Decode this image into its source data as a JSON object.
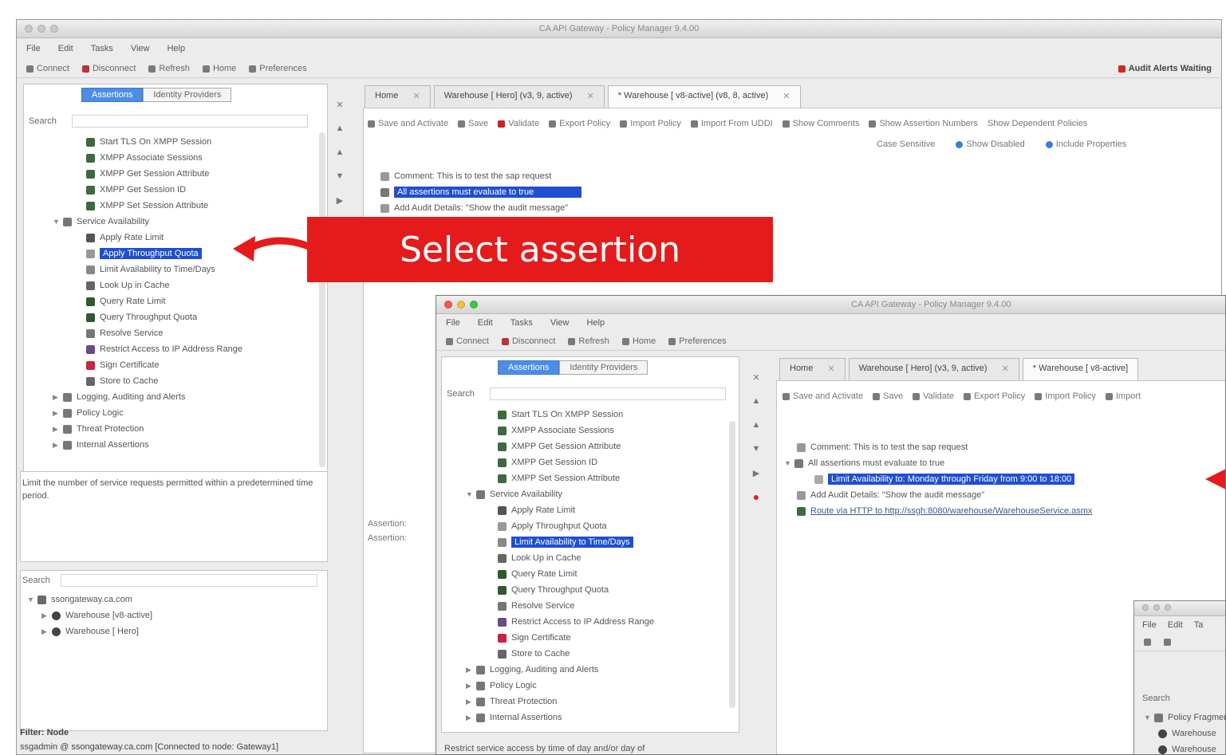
{
  "main_window": {
    "title": "CA API Gateway - Policy Manager 9.4.00",
    "menu": [
      "File",
      "Edit",
      "Tasks",
      "View",
      "Help"
    ],
    "toolbar": [
      "Connect",
      "Disconnect",
      "Refresh",
      "Home",
      "Preferences"
    ],
    "alert": "Audit Alerts Waiting",
    "left_tabs": [
      "Assertions",
      "Identity Providers"
    ],
    "search_label": "Search",
    "assertion_tree": [
      "Start TLS On XMPP Session",
      "XMPP Associate Sessions",
      "XMPP Get Session Attribute",
      "XMPP Get Session ID",
      "XMPP Set Session Attribute",
      "Service Availability",
      "Apply Rate Limit",
      "Apply Throughput Quota",
      "Limit Availability to Time/Days",
      "Look Up in Cache",
      "Query Rate Limit",
      "Query Throughput Quota",
      "Resolve Service",
      "Restrict Access to IP Address Range",
      "Sign Certificate",
      "Store to Cache",
      "Logging, Auditing and Alerts",
      "Policy Logic",
      "Threat Protection",
      "Internal Assertions"
    ],
    "description": "Limit the number of service requests permitted within a predetermined time period.",
    "bottom_search_label": "Search",
    "service_tree": [
      "ssongateway.ca.com",
      "Warehouse [v8-active]",
      "Warehouse [ Hero]"
    ],
    "filter_label": "Filter: Node",
    "status": "ssgadmin @ ssongateway.ca.com [Connected to node: Gateway1]",
    "tabs": [
      "Home",
      "Warehouse [ Hero] (v3, 9, active)",
      "* Warehouse [ v8-active] (v8, 8, active)"
    ],
    "policy_toolbar": [
      "Save and Activate",
      "Save",
      "Validate",
      "Export Policy",
      "Import Policy",
      "Import From UDDI",
      "Show Comments",
      "Show Assertion Numbers",
      "Show Dependent Policies"
    ],
    "search_bar": {
      "case": "Case Sensitive",
      "disabled": "Show Disabled",
      "props": "Include Properties"
    },
    "policy_lines": [
      "Comment: This is to test the sap request",
      "All assertions must evaluate to true",
      "Add Audit Details: \"Show the audit message\""
    ],
    "assertion_labels": [
      "Assertion:",
      "Assertion:"
    ]
  },
  "callout": {
    "text": "Select assertion"
  },
  "second_window": {
    "title": "CA API Gateway - Policy Manager 9.4.00",
    "menu": [
      "File",
      "Edit",
      "Tasks",
      "View",
      "Help"
    ],
    "toolbar": [
      "Connect",
      "Disconnect",
      "Refresh",
      "Home",
      "Preferences"
    ],
    "left_tabs": [
      "Assertions",
      "Identity Providers"
    ],
    "search_label": "Search",
    "tabs": [
      "Home",
      "Warehouse [ Hero] (v3, 9, active)",
      "* Warehouse [ v8-active]"
    ],
    "policy_toolbar": [
      "Save and Activate",
      "Save",
      "Validate",
      "Export Policy",
      "Import Policy",
      "Import"
    ],
    "policy_lines": [
      "Comment: This is to test the sap request",
      "All assertions must evaluate to true",
      "Limit Availability to: Monday through Friday from 9:00 to 18:00",
      "Add Audit Details: \"Show the audit message\"",
      "Route via HTTP to http://ssgh:8080/warehouse/WarehouseService.asmx"
    ],
    "description": "Restrict service access by time of day and/or day of"
  },
  "third_window": {
    "menu": [
      "File",
      "Edit",
      "Ta"
    ],
    "search_label": "Search",
    "tree": [
      "Policy Fragments",
      "Warehouse",
      "Warehouse"
    ]
  }
}
